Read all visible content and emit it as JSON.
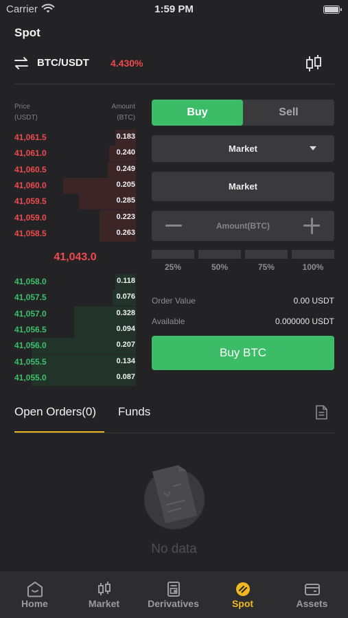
{
  "status_bar": {
    "carrier": "Carrier",
    "time": "1:59 PM"
  },
  "page": {
    "title": "Spot"
  },
  "pair": {
    "name": "BTC/USDT",
    "change": "4.430%"
  },
  "orderbook": {
    "price_header": [
      "Price",
      "(USDT)"
    ],
    "amount_header": [
      "Amount",
      "(BTC)"
    ],
    "asks": [
      {
        "price": "41,061.5",
        "amount": "0.183",
        "depth": 0.17
      },
      {
        "price": "41,061.0",
        "amount": "0.240",
        "depth": 0.22
      },
      {
        "price": "41,060.5",
        "amount": "0.249",
        "depth": 0.23
      },
      {
        "price": "41,060.0",
        "amount": "0.205",
        "depth": 0.6
      },
      {
        "price": "41,059.5",
        "amount": "0.285",
        "depth": 0.47
      },
      {
        "price": "41,059.0",
        "amount": "0.223",
        "depth": 0.3
      },
      {
        "price": "41,058.5",
        "amount": "0.263",
        "depth": 0.3
      }
    ],
    "last_price": "41,043.0",
    "bids": [
      {
        "price": "41,058.0",
        "amount": "0.118",
        "depth": 0.17
      },
      {
        "price": "41,057.5",
        "amount": "0.076",
        "depth": 0.19
      },
      {
        "price": "41,057.0",
        "amount": "0.328",
        "depth": 0.51
      },
      {
        "price": "41,056.5",
        "amount": "0.094",
        "depth": 0.51
      },
      {
        "price": "41,056.0",
        "amount": "0.207",
        "depth": 0.86
      },
      {
        "price": "41,055.5",
        "amount": "0.134",
        "depth": 0.86
      },
      {
        "price": "41,055.0",
        "amount": "0.087",
        "depth": 0.86
      }
    ]
  },
  "trade": {
    "buy_label": "Buy",
    "sell_label": "Sell",
    "order_type": "Market",
    "price_field": "Market",
    "amount_placeholder": "Amount(BTC)",
    "percent_options": [
      "25%",
      "50%",
      "75%",
      "100%"
    ],
    "order_value_label": "Order Value",
    "order_value": "0.00 USDT",
    "available_label": "Available",
    "available_value": "0.000000 USDT",
    "submit_label": "Buy BTC"
  },
  "tabs": {
    "open_orders": "Open Orders(0)",
    "funds": "Funds"
  },
  "empty_state": {
    "text": "No data"
  },
  "bottom_nav": [
    {
      "label": "Home",
      "icon": "home-icon"
    },
    {
      "label": "Market",
      "icon": "candlestick-icon"
    },
    {
      "label": "Derivatives",
      "icon": "derivatives-icon"
    },
    {
      "label": "Spot",
      "icon": "spot-icon",
      "active": true
    },
    {
      "label": "Assets",
      "icon": "wallet-icon"
    }
  ],
  "colors": {
    "background": "#232325",
    "buy_green": "#3cbc66",
    "sell_red": "#ee4a4f",
    "accent_yellow": "#f0b922"
  }
}
